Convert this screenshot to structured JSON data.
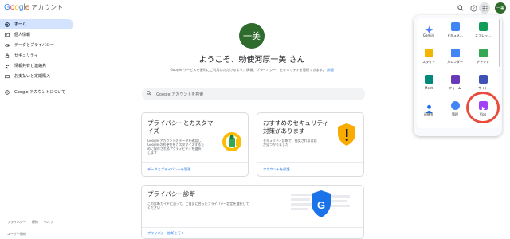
{
  "header": {
    "logo_letters": [
      {
        "ch": "G",
        "color": "#4285f4"
      },
      {
        "ch": "o",
        "color": "#ea4335"
      },
      {
        "ch": "o",
        "color": "#fbbc05"
      },
      {
        "ch": "g",
        "color": "#4285f4"
      },
      {
        "ch": "l",
        "color": "#34a853"
      },
      {
        "ch": "e",
        "color": "#ea4335"
      }
    ],
    "logo_suffix": "アカウント",
    "icons": [
      "search-icon",
      "help-icon",
      "apps-grid-icon"
    ],
    "avatar_text": "一美"
  },
  "sidebar": {
    "items": [
      {
        "label": "ホーム",
        "icon": "home-icon",
        "active": true
      },
      {
        "label": "個人情報",
        "icon": "id-card-icon"
      },
      {
        "label": "データとプライバシー",
        "icon": "toggle-icon"
      },
      {
        "label": "セキュリティ",
        "icon": "lock-icon"
      },
      {
        "label": "情報共有と連絡先",
        "icon": "people-icon"
      },
      {
        "label": "お支払いと定期購入",
        "icon": "card-icon"
      },
      {
        "label": "Google アカウントについて",
        "icon": "info-icon"
      }
    ],
    "footer_links": [
      "プライバシー",
      "規約",
      "ヘルプ"
    ],
    "footer2": "ユーザー情報"
  },
  "main": {
    "avatar_text": "一美",
    "welcome": "ようこそ、勅使河原一美 さん",
    "subtitle": "Google サービスを便利にご利用いただけるよう、情報、プライバシー、セキュリティを管理できます。",
    "subtitle_link": "詳細",
    "search_placeholder": "Google アカウントを検索",
    "cards": {
      "privacy": {
        "title1": "プライバシーとカスタマ",
        "title2": "イズ",
        "text": [
          "Google アカウントのデータを確認し、",
          "Google の利便性をカスタマイズするた",
          "めに保存されるアクティビティを選択",
          "します"
        ],
        "link": "データとプライバシーを管理"
      },
      "security": {
        "title1": "おすすめのセキュリティ",
        "title2": "対策があります",
        "text": [
          "セキュリティ診断で、推奨される対応",
          "が見つかりました"
        ],
        "link": "アカウントを保護"
      },
      "checkup": {
        "title": "プライバシー診断",
        "text": [
          "この診断ガイドに沿って、ご自身に合ったプライバシー設定を選択して",
          "ください"
        ],
        "link": "プライバシー診断を行う"
      }
    }
  },
  "apps_panel": {
    "apps": [
      {
        "label": "Gemini",
        "color": "#4f7cf7",
        "icon": "gemini-icon"
      },
      {
        "label": "ドキュメ…",
        "color": "#4285f4",
        "icon": "docs-icon"
      },
      {
        "label": "スプレッ…",
        "color": "#0f9d58",
        "icon": "sheets-icon"
      },
      {
        "label": "スライド",
        "color": "#f4b400",
        "icon": "slides-icon"
      },
      {
        "label": "カレンダー",
        "color": "#4285f4",
        "icon": "calendar-icon"
      },
      {
        "label": "チャット",
        "color": "#34a853",
        "icon": "chat-icon"
      },
      {
        "label": "Meet",
        "color": "#00897b",
        "icon": "meet-icon"
      },
      {
        "label": "フォーム",
        "color": "#673ab7",
        "icon": "forms-icon"
      },
      {
        "label": "サイト",
        "color": "#3f51b5",
        "icon": "sites-icon"
      },
      {
        "label": "連絡先",
        "color": "#1a73e8",
        "icon": "contacts-icon"
      },
      {
        "label": "管理",
        "color": "#4285f4",
        "icon": "admin-icon"
      },
      {
        "label": "Vids",
        "color": "#a142f4",
        "icon": "vids-icon"
      }
    ]
  }
}
